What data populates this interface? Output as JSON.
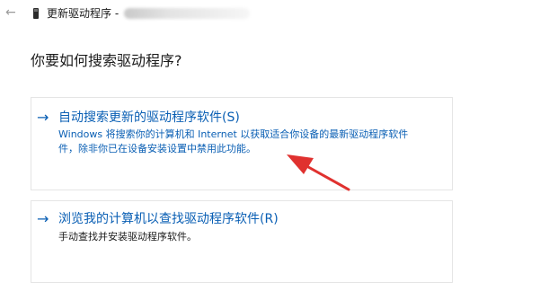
{
  "window": {
    "title": "更新驱动程序 -",
    "back_icon": "back-arrow-icon",
    "device_icon": "device-icon"
  },
  "main": {
    "question": "你要如何搜索驱动程序?",
    "options": [
      {
        "arrow": "→",
        "title": "自动搜索更新的驱动程序软件(S)",
        "description_lines": [
          "Windows 将搜索你的计算机和 Internet 以获取适合你设备的最新驱动程序软件",
          "件，除非你已在设备安装设置中禁用此功能。"
        ]
      },
      {
        "arrow": "→",
        "title": "浏览我的计算机以查找驱动程序软件(R)",
        "description_lines": [
          "手动查找并安装驱动程序软件。"
        ]
      }
    ]
  },
  "colors": {
    "accent": "#0a5fb4",
    "annotation": "#e0312f",
    "border": "#e5e5e5"
  }
}
